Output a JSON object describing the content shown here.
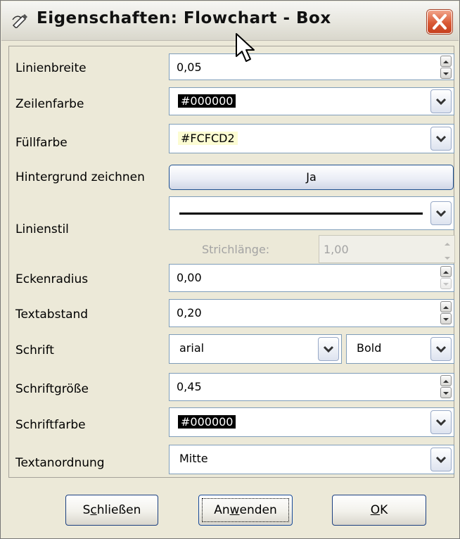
{
  "window": {
    "title": "Eigenschaften: Flowchart - Box",
    "title_icon": "pencil-properties-icon",
    "close_icon": "close-x-icon"
  },
  "rows": {
    "linienbreite": {
      "label": "Linienbreite",
      "value": "0,05"
    },
    "zeilenfarbe": {
      "label": "Zeilenfarbe",
      "value": "#000000",
      "swatch": "#000000"
    },
    "fuellfarbe": {
      "label": "Füllfarbe",
      "value": "#FCFCD2",
      "swatch": "#FCFCD2"
    },
    "hintergrund": {
      "label": "Hintergrund zeichnen",
      "value": "Ja"
    },
    "linienstil": {
      "label": "Linienstil",
      "dash_label": "Strichlänge:",
      "dash_value": "1,00"
    },
    "eckenradius": {
      "label": "Eckenradius",
      "value": "0,00"
    },
    "textabstand": {
      "label": "Textabstand",
      "value": "0,20"
    },
    "schrift": {
      "label": "Schrift",
      "font": "arial",
      "style": "Bold"
    },
    "schriftgroesse": {
      "label": "Schriftgröße",
      "value": "0,45"
    },
    "schriftfarbe": {
      "label": "Schriftfarbe",
      "value": "#000000",
      "swatch": "#000000"
    },
    "textanordnung": {
      "label": "Textanordnung",
      "value": "Mitte"
    }
  },
  "buttons": {
    "close_pre": "S",
    "close_u": "c",
    "close_post": "hließen",
    "apply_pre": "An",
    "apply_u": "w",
    "apply_post": "enden",
    "ok_u": "O",
    "ok_post": "K"
  }
}
